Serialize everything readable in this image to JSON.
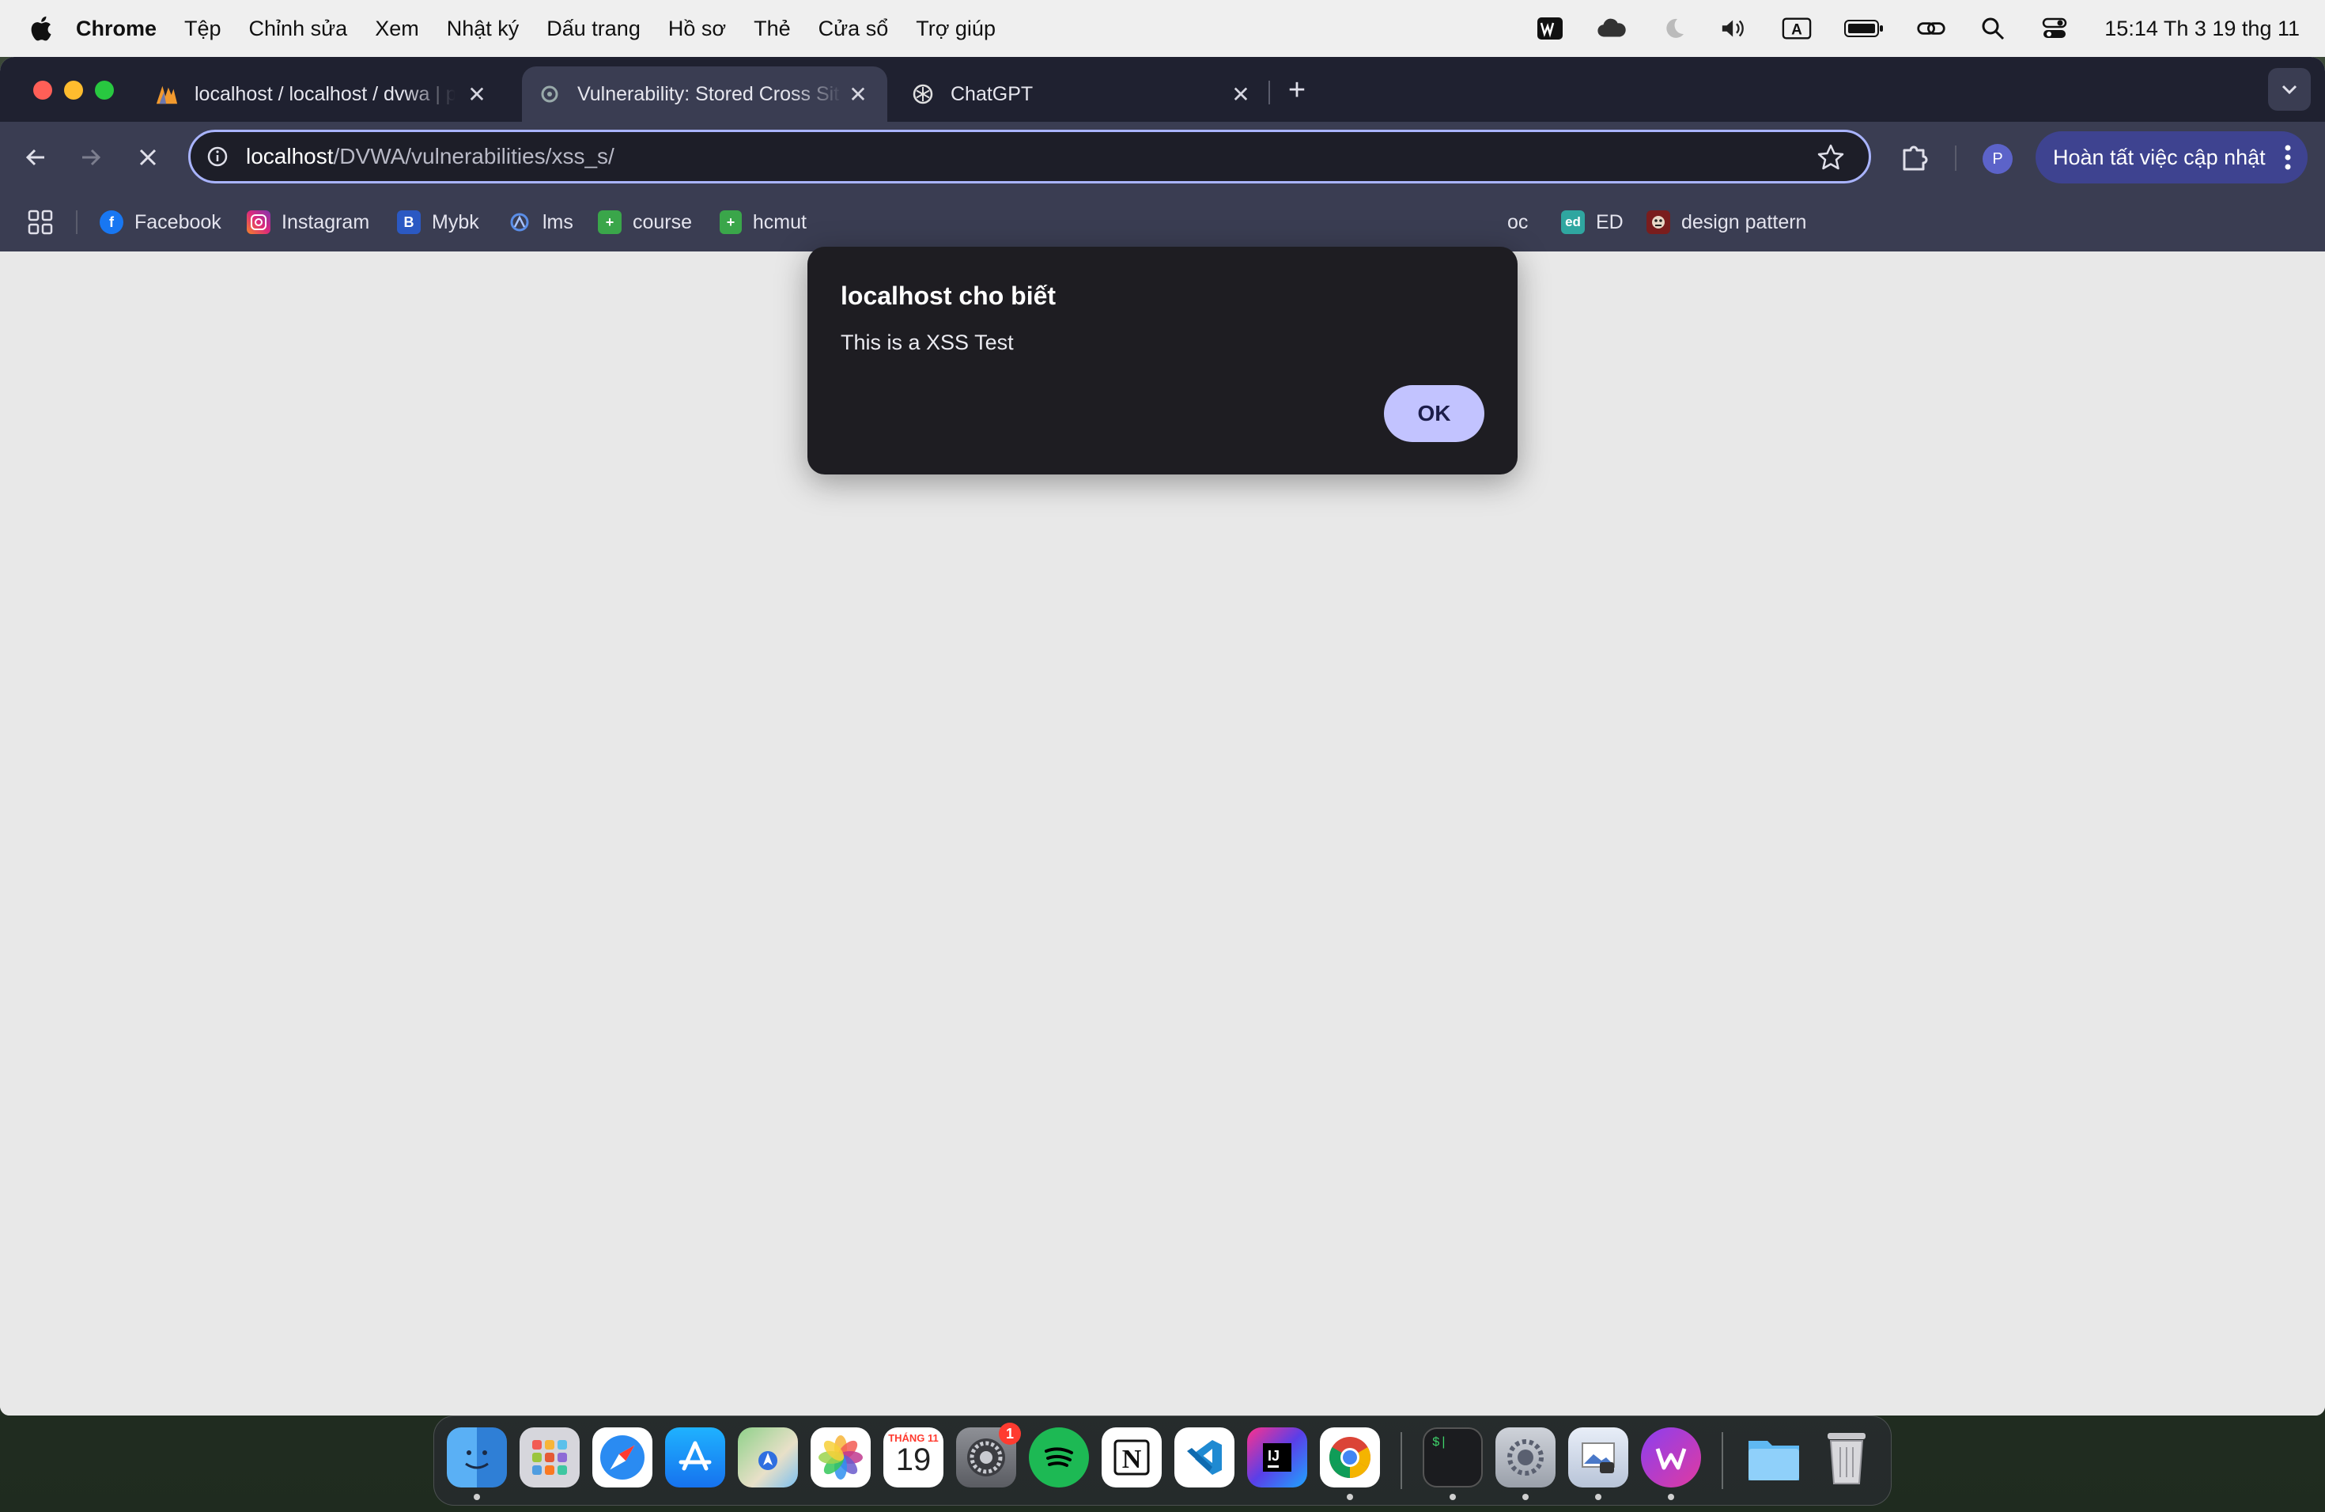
{
  "menubar": {
    "items": [
      "Chrome",
      "Tệp",
      "Chỉnh sửa",
      "Xem",
      "Nhật ký",
      "Dấu trang",
      "Hồ sơ",
      "Thẻ",
      "Cửa sổ",
      "Trợ giúp"
    ],
    "clock": "15:14 Th 3 19 thg 11",
    "input_source": "A"
  },
  "tabs": [
    {
      "title": "localhost / localhost / dvwa | p",
      "icon": "phpmyadmin-icon",
      "active": false
    },
    {
      "title": "Vulnerability: Stored Cross Sit",
      "icon": "dvwa-icon",
      "active": true
    },
    {
      "title": "ChatGPT",
      "icon": "chatgpt-icon",
      "active": false
    }
  ],
  "omnibox": {
    "host": "localhost",
    "path": "/DVWA/vulnerabilities/xss_s/"
  },
  "profile_initial": "P",
  "update_button": "Hoàn tất việc cập nhật",
  "bookmarks": [
    {
      "label": "Facebook",
      "icon": "facebook-icon",
      "color": "#1877f2"
    },
    {
      "label": "Instagram",
      "icon": "instagram-icon",
      "color": "#d6249f"
    },
    {
      "label": "Mybk",
      "icon": "mybk-icon",
      "color": "#2b59c3"
    },
    {
      "label": "lms",
      "icon": "lms-icon",
      "color": "#3b6fd8"
    },
    {
      "label": "course",
      "icon": "course-icon",
      "color": "#3aa64a"
    },
    {
      "label": "hcmut",
      "icon": "hcmut-icon",
      "color": "#3aa64a"
    },
    {
      "label": "oc",
      "icon": "",
      "color": ""
    },
    {
      "label": "ED",
      "icon": "ed-icon",
      "color": "#2fa6a0"
    },
    {
      "label": "design pattern",
      "icon": "design-pattern-icon",
      "color": "#7a1d1d"
    }
  ],
  "dialog": {
    "title": "localhost cho biết",
    "message": "This is a XSS Test",
    "ok_label": "OK"
  },
  "dock": {
    "calendar_month": "THÁNG 11",
    "calendar_day": "19",
    "settings_badge": "1",
    "apps": [
      "Finder",
      "Launchpad",
      "Safari",
      "App Store",
      "Maps",
      "Photos",
      "Calendar",
      "System Settings",
      "Spotify",
      "Notion",
      "Visual Studio Code",
      "IntelliJ IDEA",
      "Chrome",
      "Terminal",
      "Utility",
      "Preview",
      "Wondershare",
      "Downloads",
      "Trash"
    ]
  },
  "colors": {
    "accent": "#a9b4ff",
    "dialog_bg": "#1e1d22",
    "ok_button": "#c2c3ff",
    "toolbar": "#3a3d52"
  }
}
